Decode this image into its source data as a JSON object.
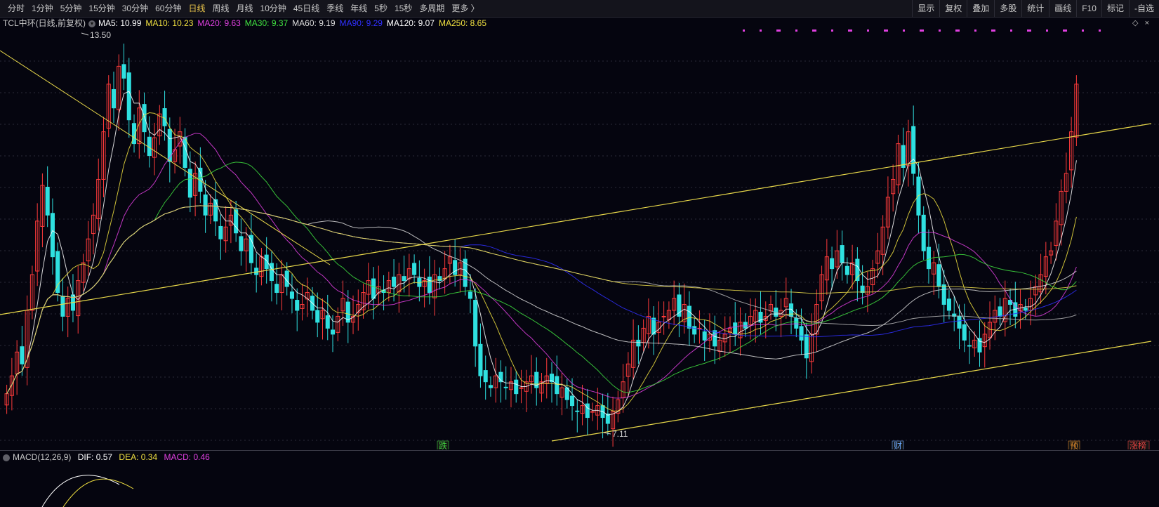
{
  "toolbar": {
    "periods": [
      "分时",
      "1分钟",
      "5分钟",
      "15分钟",
      "30分钟",
      "60分钟",
      "日线",
      "周线",
      "月线",
      "10分钟",
      "45日线",
      "季线",
      "年线",
      "5秒",
      "15秒",
      "多周期",
      "更多 〉"
    ],
    "active_period": "日线",
    "tools": [
      "显示",
      "复权",
      "叠加",
      "多股",
      "统计",
      "画线",
      "F10",
      "标记",
      "-自选"
    ]
  },
  "legend": {
    "stock": "TCL中环(日线,前复权)",
    "ma": [
      {
        "label": "MA5: 10.99",
        "color": "#ffffff"
      },
      {
        "label": "MA10: 10.23",
        "color": "#f0e040"
      },
      {
        "label": "MA20: 9.63",
        "color": "#e040e0"
      },
      {
        "label": "MA30: 9.37",
        "color": "#40e040"
      },
      {
        "label": "MA60: 9.19",
        "color": "#dcdcdc"
      },
      {
        "label": "MA90: 9.29",
        "color": "#3030ff"
      },
      {
        "label": "MA120: 9.07",
        "color": "#ffffff"
      },
      {
        "label": "MA250: 8.65",
        "color": "#f0e040"
      }
    ]
  },
  "annotations": {
    "high": "13.50",
    "low": "7.11",
    "markers": [
      {
        "text": "跌",
        "color": "#40d040"
      },
      {
        "text": "财",
        "color": "#6aa8ff"
      },
      {
        "text": "预",
        "color": "#e08a2a"
      },
      {
        "text": "涨榜",
        "color": "#e04040"
      }
    ]
  },
  "right_icons": {
    "diamond": "◇",
    "close": "×"
  },
  "macd": {
    "title": "MACD(12,26,9)",
    "dif": "DIF: 0.57",
    "dea": "DEA: 0.34",
    "macd": "MACD: 0.46"
  },
  "colors": {
    "up": "#ff3b3b",
    "down": "#2fe0e0",
    "bg": "#05050f"
  },
  "chart_data": {
    "type": "candlestick",
    "price_range": [
      6.9,
      13.6
    ],
    "close": [
      7.6,
      7.9,
      8.3,
      8.1,
      9.0,
      9.6,
      10.5,
      11.1,
      10.6,
      9.9,
      9.3,
      8.9,
      9.2,
      9.0,
      9.5,
      9.8,
      10.2,
      10.6,
      11.2,
      12.0,
      12.8,
      12.4,
      13.1,
      12.9,
      12.2,
      11.8,
      12.4,
      12.0,
      11.6,
      11.9,
      12.3,
      12.1,
      11.5,
      11.7,
      12.0,
      11.4,
      10.9,
      11.3,
      11.0,
      10.6,
      10.8,
      10.5,
      10.2,
      10.4,
      10.6,
      10.3,
      10.0,
      10.2,
      9.8,
      9.6,
      9.9,
      9.7,
      9.5,
      9.3,
      9.6,
      9.4,
      9.2,
      9.0,
      9.1,
      9.3,
      9.0,
      8.8,
      9.0,
      8.7,
      8.6,
      8.9,
      9.2,
      8.8,
      8.9,
      9.1,
      9.3,
      9.5,
      9.2,
      9.4,
      9.3,
      9.5,
      9.4,
      9.6,
      9.5,
      9.7,
      9.6,
      9.4,
      9.5,
      9.3,
      9.6,
      9.5,
      9.7,
      9.9,
      9.6,
      9.8,
      9.4,
      9.2,
      8.4,
      7.9,
      7.8,
      7.7,
      7.9,
      7.8,
      7.7,
      7.8,
      7.6,
      7.7,
      7.8,
      7.9,
      7.7,
      7.8,
      7.9,
      7.8,
      7.6,
      7.7,
      7.5,
      7.4,
      7.3,
      7.4,
      7.2,
      7.3,
      7.4,
      7.2,
      7.1,
      7.3,
      7.5,
      7.8,
      8.1,
      8.5,
      8.4,
      8.7,
      8.9,
      8.6,
      8.8,
      8.9,
      9.0,
      9.2,
      8.9,
      9.1,
      8.7,
      8.6,
      8.7,
      8.5,
      8.6,
      8.4,
      8.5,
      8.6,
      8.7,
      8.6,
      8.8,
      8.7,
      8.9,
      9.0,
      8.8,
      8.9,
      9.1,
      8.9,
      9.0,
      9.2,
      8.9,
      8.7,
      8.5,
      8.2,
      8.6,
      9.1,
      9.6,
      9.9,
      9.7,
      10.0,
      9.8,
      9.6,
      9.8,
      9.5,
      9.3,
      9.4,
      9.7,
      10.0,
      10.4,
      10.9,
      11.2,
      11.8,
      11.4,
      12.0,
      11.3,
      10.6,
      10.0,
      9.7,
      9.8,
      9.4,
      9.1,
      9.0,
      8.9,
      8.7,
      8.5,
      8.4,
      8.5,
      8.3,
      8.6,
      8.8,
      9.0,
      8.9,
      9.2,
      9.1,
      8.9,
      9.1,
      9.0,
      9.2,
      9.4,
      9.6,
      9.9,
      10.0,
      10.5,
      11.0,
      11.3,
      12.0,
      12.8
    ]
  }
}
